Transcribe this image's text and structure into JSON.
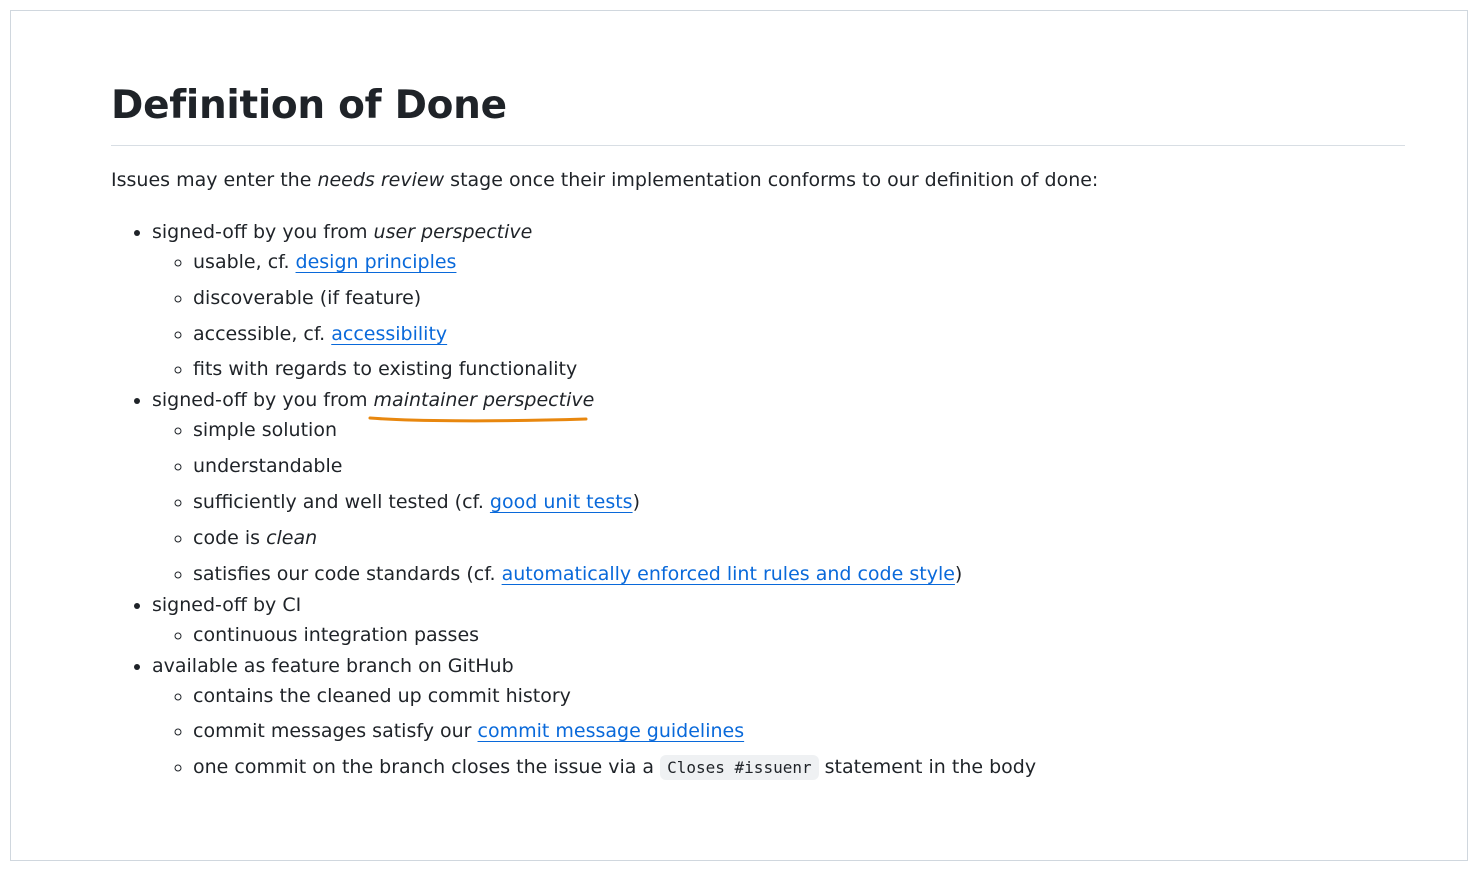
{
  "title": "Definition of Done",
  "intro": {
    "before": "Issues may enter the ",
    "em": "needs review",
    "after": " stage once their implementation conforms to our definition of done:"
  },
  "sections": [
    {
      "prefix": "signed-off by you from ",
      "em": "user perspective",
      "items": [
        {
          "text": "usable, cf. ",
          "link": "design principles"
        },
        {
          "text": "discoverable (if feature)"
        },
        {
          "text": "accessible, cf. ",
          "link": "accessibility"
        },
        {
          "text": "fits with regards to existing functionality"
        }
      ]
    },
    {
      "prefix": "signed-off by you from ",
      "em": "maintainer perspective",
      "items": [
        {
          "text": "simple solution"
        },
        {
          "text": "understandable"
        },
        {
          "text": "sufficiently and well tested (cf. ",
          "link": "good unit tests",
          "after": ")"
        },
        {
          "text": "code is ",
          "em": "clean"
        },
        {
          "text": "satisfies our code standards (cf. ",
          "link": "automatically enforced lint rules and code style",
          "after": ")"
        }
      ]
    },
    {
      "prefix": "signed-off by CI",
      "items": [
        {
          "text": "continuous integration passes"
        }
      ]
    },
    {
      "prefix": "available as feature branch on GitHub",
      "items": [
        {
          "text": "contains the cleaned up commit history"
        },
        {
          "text": "commit messages satisfy our ",
          "link": "commit message guidelines"
        },
        {
          "text": "one commit on the branch closes the issue via a ",
          "code": "Closes #issuenr",
          "after": " statement in the body"
        }
      ]
    }
  ],
  "colors": {
    "text": "#1f2328",
    "link": "#0969da",
    "highlight_underline": "#e8870e",
    "code_bg": "#eff1f3",
    "border": "#d0d7de"
  }
}
